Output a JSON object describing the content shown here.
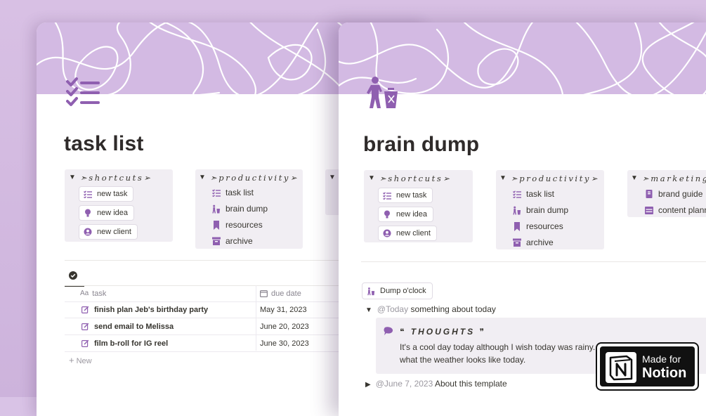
{
  "colors": {
    "accent": "#8f5fb0",
    "cover": "#d3bae3",
    "callout_bg": "#f1eef3"
  },
  "left_page": {
    "title": "task list",
    "icon": "checklist-icon",
    "callouts": [
      {
        "heading": "➣shortcuts➢",
        "items": [
          {
            "label": "new task",
            "icon": "checklist-icon"
          },
          {
            "label": "new idea",
            "icon": "lightbulb-icon"
          },
          {
            "label": "new client",
            "icon": "user-circle-icon"
          }
        ]
      },
      {
        "heading": "➣productivity➢",
        "items": [
          {
            "label": "task list",
            "icon": "checklist-icon"
          },
          {
            "label": "brain dump",
            "icon": "trash-person-icon"
          },
          {
            "label": "resources",
            "icon": "bookmark-icon"
          },
          {
            "label": "archive",
            "icon": "archive-icon"
          }
        ]
      }
    ],
    "db_tab_icon": "check-circle-icon",
    "table": {
      "columns": [
        {
          "label": "task",
          "icon": "text-aa-icon"
        },
        {
          "label": "due date",
          "icon": "calendar-icon"
        }
      ],
      "rows": [
        {
          "task": "finish plan Jeb's birthday party",
          "due": "May 31, 2023"
        },
        {
          "task": "send email to Melissa",
          "due": "June 20, 2023"
        },
        {
          "task": "film b-roll for IG reel",
          "due": "June 30, 2023"
        }
      ],
      "new_label": "New"
    }
  },
  "right_page": {
    "title": "brain dump",
    "icon": "trash-person-icon",
    "callouts": [
      {
        "heading": "➣shortcuts➢",
        "items": [
          {
            "label": "new task"
          },
          {
            "label": "new idea"
          },
          {
            "label": "new client"
          }
        ]
      },
      {
        "heading": "➣productivity➢",
        "items": [
          {
            "label": "task list"
          },
          {
            "label": "brain dump"
          },
          {
            "label": "resources"
          },
          {
            "label": "archive"
          }
        ]
      },
      {
        "heading": "➣marketing",
        "items": [
          {
            "label": "brand guide",
            "icon": "book-icon"
          },
          {
            "label": "content plann",
            "icon": "table-icon"
          }
        ]
      }
    ],
    "button_label": "Dump o'clock",
    "entries": [
      {
        "date": "@Today",
        "text": "something about today",
        "expanded": true
      },
      {
        "date": "@June 7, 2023",
        "text": "About this template",
        "expanded": false
      }
    ],
    "thoughts": {
      "heading": "❝ THOUGHTS ❞",
      "line1": "It's a cool day today although I wish today was rainy. I lo",
      "line2": "what the weather looks like today."
    }
  },
  "badge": {
    "line1": "Made for",
    "line2": "Notion"
  }
}
